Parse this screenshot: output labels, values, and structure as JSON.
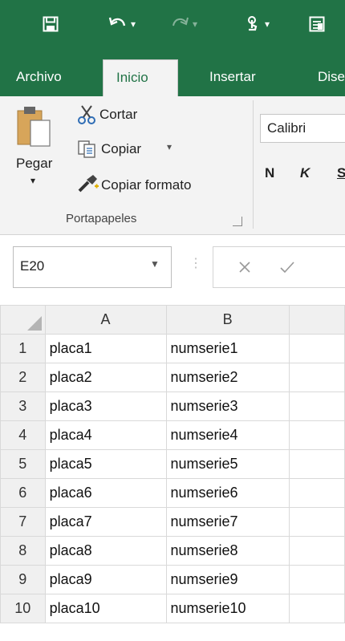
{
  "ribbon": {
    "tabs": [
      {
        "label": "Archivo"
      },
      {
        "label": "Inicio"
      },
      {
        "label": "Insertar"
      },
      {
        "label": "Dise"
      }
    ],
    "clipboard": {
      "paste_label": "Pegar",
      "cut_label": "Cortar",
      "copy_label": "Copiar",
      "format_painter_label": "Copiar formato",
      "group_label": "Portapapeles"
    },
    "font": {
      "name": "Calibri",
      "bold_label": "N",
      "italic_label": "K",
      "underline_label": "S"
    }
  },
  "formula_bar": {
    "name_box": "E20"
  },
  "sheet": {
    "columns": [
      "A",
      "B"
    ],
    "rows": [
      {
        "num": "1",
        "a": "placa1",
        "b": "numserie1"
      },
      {
        "num": "2",
        "a": "placa2",
        "b": "numserie2"
      },
      {
        "num": "3",
        "a": "placa3",
        "b": "numserie3"
      },
      {
        "num": "4",
        "a": "placa4",
        "b": "numserie4"
      },
      {
        "num": "5",
        "a": "placa5",
        "b": "numserie5"
      },
      {
        "num": "6",
        "a": "placa6",
        "b": "numserie6"
      },
      {
        "num": "7",
        "a": "placa7",
        "b": "numserie7"
      },
      {
        "num": "8",
        "a": "placa8",
        "b": "numserie8"
      },
      {
        "num": "9",
        "a": "placa9",
        "b": "numserie9"
      },
      {
        "num": "10",
        "a": "placa10",
        "b": "numserie10"
      }
    ]
  },
  "colors": {
    "excel_green": "#217346",
    "ribbon_bg": "#f3f3f3"
  }
}
